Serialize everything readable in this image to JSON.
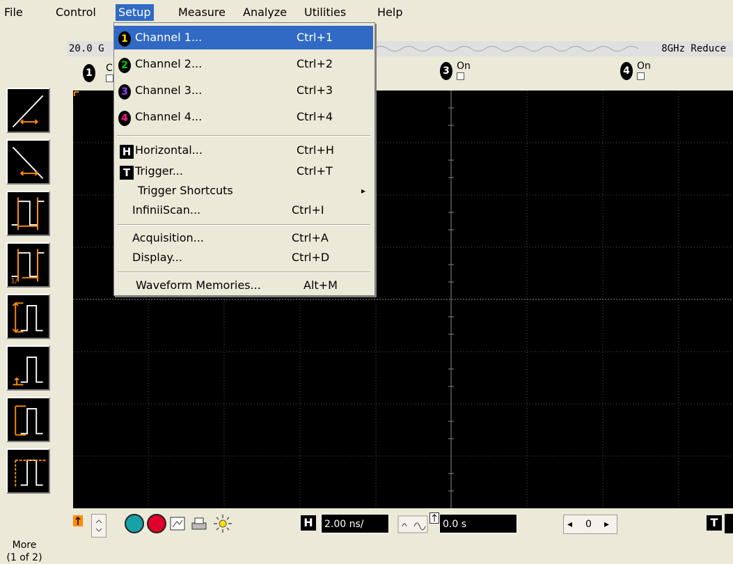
{
  "menubar": {
    "items": [
      "File",
      "Control",
      "Setup",
      "Measure",
      "Analyze",
      "Utilities",
      "Help"
    ],
    "active": "Setup"
  },
  "info": {
    "sample_rate_left": "20.0 G",
    "bandwidth_right": "8GHz Reduce"
  },
  "channels": [
    {
      "num": "1",
      "state": "C"
    },
    {
      "num": "3",
      "state": "On"
    },
    {
      "num": "4",
      "state": "On"
    }
  ],
  "setup_menu": {
    "items": [
      {
        "label": "Channel 1...",
        "shortcut": "Ctrl+1",
        "icon_text": "1",
        "icon_color": "#ffe000"
      },
      {
        "label": "Channel 2...",
        "shortcut": "Ctrl+2",
        "icon_text": "2",
        "icon_color": "#00d000"
      },
      {
        "label": "Channel 3...",
        "shortcut": "Ctrl+3",
        "icon_text": "3",
        "icon_color": "#8a2be2"
      },
      {
        "label": "Channel 4...",
        "shortcut": "Ctrl+4",
        "icon_text": "4",
        "icon_color": "#ff1493"
      },
      {
        "label": "Horizontal...",
        "shortcut": "Ctrl+H",
        "icon_text": "H"
      },
      {
        "label": "Trigger...",
        "shortcut": "Ctrl+T",
        "icon_text": "T"
      },
      {
        "label": "Trigger Shortcuts",
        "shortcut": ""
      },
      {
        "label": "InfiniiScan...",
        "shortcut": "Ctrl+I"
      },
      {
        "label": "Acquisition...",
        "shortcut": "Ctrl+A"
      },
      {
        "label": "Display...",
        "shortcut": "Ctrl+D"
      },
      {
        "label": "Waveform Memories...",
        "shortcut": "Alt+M"
      }
    ],
    "submenu_arrow": "▸"
  },
  "left_panel": {
    "more_label": "More",
    "more_page": "(1 of 2)"
  },
  "bottom": {
    "h_icon": "H",
    "timebase": "2.00 ns/",
    "delay": "0.0 s",
    "position": "0",
    "t_icon": "T"
  },
  "colors": {
    "accent": "#316ac5",
    "trace_orange": "#ff8c00",
    "grid": "#555555"
  }
}
